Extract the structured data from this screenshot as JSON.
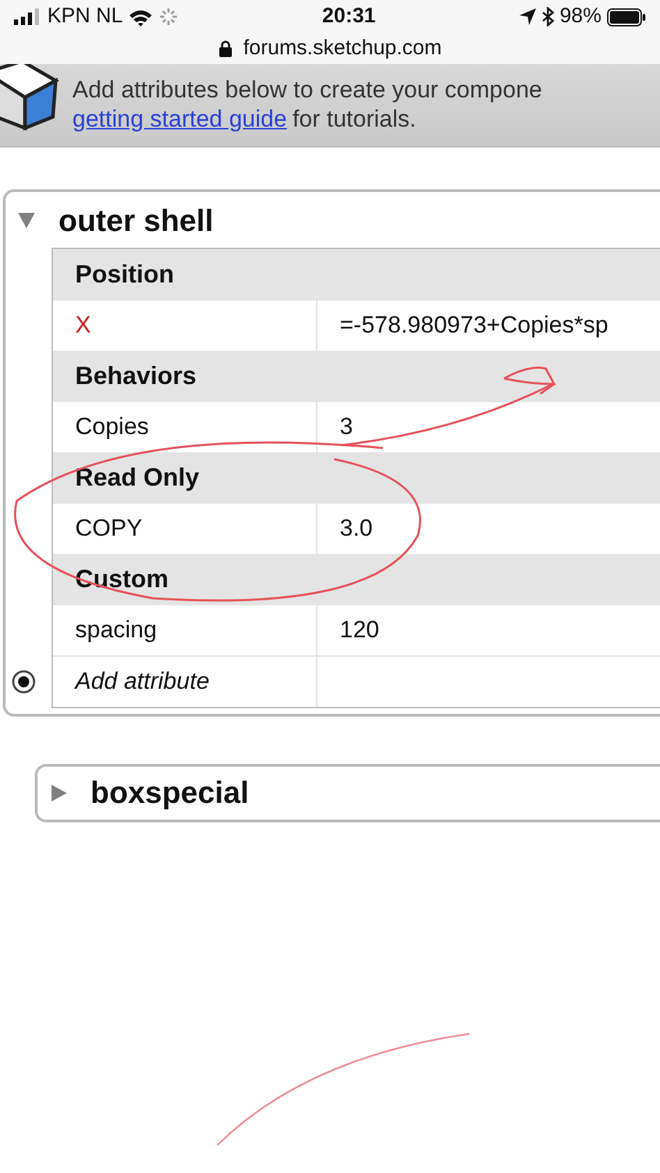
{
  "status_bar": {
    "carrier": "KPN NL",
    "time": "20:31",
    "battery": "98%"
  },
  "address_bar": {
    "url": "forums.sketchup.com"
  },
  "banner": {
    "text": "Add attributes below to create your compone",
    "link": "getting started guide",
    "link_tail": "for tutorials."
  },
  "panels": [
    {
      "title": "outer shell",
      "expanded": true,
      "rows": [
        {
          "kind": "section",
          "label": "Position"
        },
        {
          "kind": "attribute",
          "name": "X",
          "value": "=-578.980973+Copies*sp",
          "highlighted": true
        },
        {
          "kind": "section",
          "label": "Behaviors"
        },
        {
          "kind": "attribute",
          "name": "Copies",
          "value": "3",
          "highlighted": false
        },
        {
          "kind": "section",
          "label": "Read Only"
        },
        {
          "kind": "attribute",
          "name": "COPY",
          "value": "3.0",
          "highlighted": false
        },
        {
          "kind": "section",
          "label": "Custom"
        },
        {
          "kind": "attribute",
          "name": "spacing",
          "value": "120",
          "highlighted": false
        },
        {
          "kind": "add",
          "label": "Add attribute"
        }
      ]
    },
    {
      "title": "boxspecial",
      "expanded": false
    }
  ]
}
